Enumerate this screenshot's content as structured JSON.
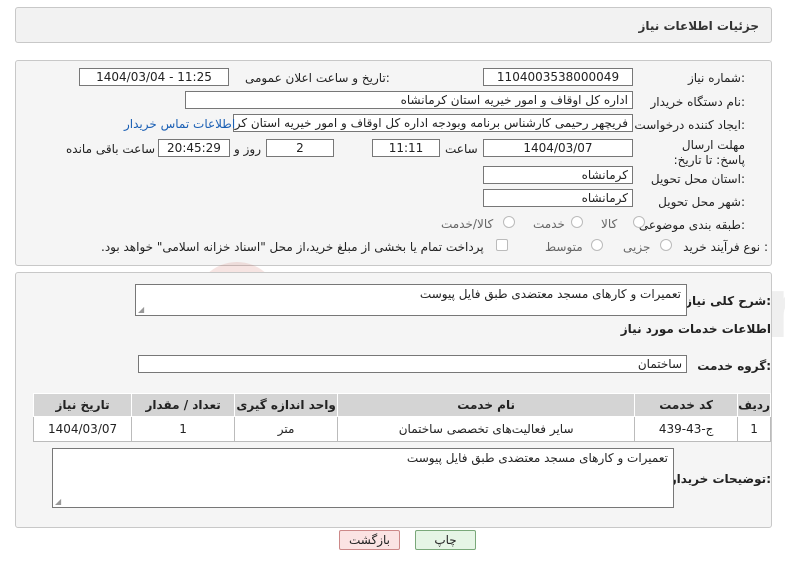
{
  "header": {
    "title": "جزئیات اطلاعات نیاز"
  },
  "fields": {
    "need_number_label": "شماره نیاز:",
    "need_number": "1104003538000049",
    "announce_label": "تاریخ و ساعت اعلان عمومی:",
    "announce_value": "1404/03/04 - 11:25",
    "buyer_org_label": "نام دستگاه خریدار:",
    "buyer_org": "اداره کل اوقاف و امور خیریه استان کرمانشاه",
    "creator_label": "ایجاد کننده درخواست:",
    "creator": "فریچهر رحیمی کارشناس برنامه وبودجه اداره کل اوقاف و امور خیریه استان کرمانشاه",
    "contact_link": "اطلاعات تماس خریدار",
    "deadline_label": "مهلت ارسال پاسخ: تا تاریخ:",
    "deadline_date": "1404/03/07",
    "time_label": "ساعت",
    "deadline_time": "11:11",
    "days_value": "2",
    "days_label": "روز و",
    "remaining_time": "20:45:29",
    "remaining_label": "ساعت باقی مانده",
    "province_label": "استان محل تحویل:",
    "province": "کرمانشاه",
    "city_label": "شهر محل تحویل:",
    "city": "کرمانشاه",
    "category_label": "طبقه بندی موضوعی:",
    "category_options": [
      "کالا",
      "خدمت",
      "کالا/خدمت"
    ],
    "process_label": "نوع فرآیند خرید :",
    "process_options": [
      "جزیی",
      "متوسط"
    ],
    "payment_note": "پرداخت تمام یا بخشی از مبلغ خرید،از محل \"اسناد خزانه اسلامی\" خواهد بود."
  },
  "summary": {
    "label": "شرح کلی نیاز:",
    "text": "تعمیرات و کارهای  مسجد  معتضدی طبق فایل پیوست"
  },
  "services": {
    "section_title": "اطلاعات خدمات مورد نیاز",
    "group_label": "گروه خدمت:",
    "group_value": "ساختمان",
    "columns": [
      "ردیف",
      "کد خدمت",
      "نام خدمت",
      "واحد اندازه گیری",
      "تعداد / مقدار",
      "تاریخ نیاز"
    ],
    "rows": [
      [
        "1",
        "ج-43-439",
        "سایر فعالیت‌های تخصصی ساختمان",
        "متر",
        "1",
        "1404/03/07"
      ]
    ]
  },
  "buyer_notes": {
    "label": "توضیحات خریدار:",
    "text": "تعمیرات و کارهای  مسجد  معتضدی طبق فایل پیوست"
  },
  "buttons": {
    "print": "چاپ",
    "back": "بازگشت"
  },
  "watermark": {
    "text": "AriaTender.neT"
  },
  "colors": {
    "link": "#1a5fb4",
    "print_bg": "#e6f5e6",
    "back_bg": "#fbe3e3"
  }
}
